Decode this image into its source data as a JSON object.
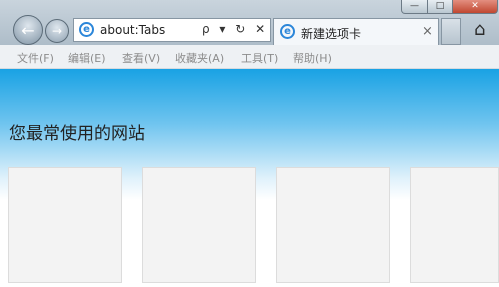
{
  "address_bar": {
    "url": "about:Tabs",
    "tools": "ρ ▾ ↻ ✕"
  },
  "tab": {
    "title": "新建选项卡",
    "close": "×"
  },
  "menu": {
    "items": [
      {
        "label": "文件(F)"
      },
      {
        "label": "编辑(E)"
      },
      {
        "label": "查看(V)"
      },
      {
        "label": "收藏夹(A)"
      },
      {
        "label": "工具(T)"
      },
      {
        "label": "帮助(H)"
      }
    ]
  },
  "content": {
    "heading": "您最常使用的网站"
  },
  "colors": {
    "sky_top": "#19a2e4",
    "chrome": "#c9d4dd",
    "close": "#c04730"
  },
  "icons": [
    "back-icon",
    "forward-icon",
    "ie-icon",
    "search-icon",
    "refresh-icon",
    "stop-icon",
    "home-icon"
  ]
}
